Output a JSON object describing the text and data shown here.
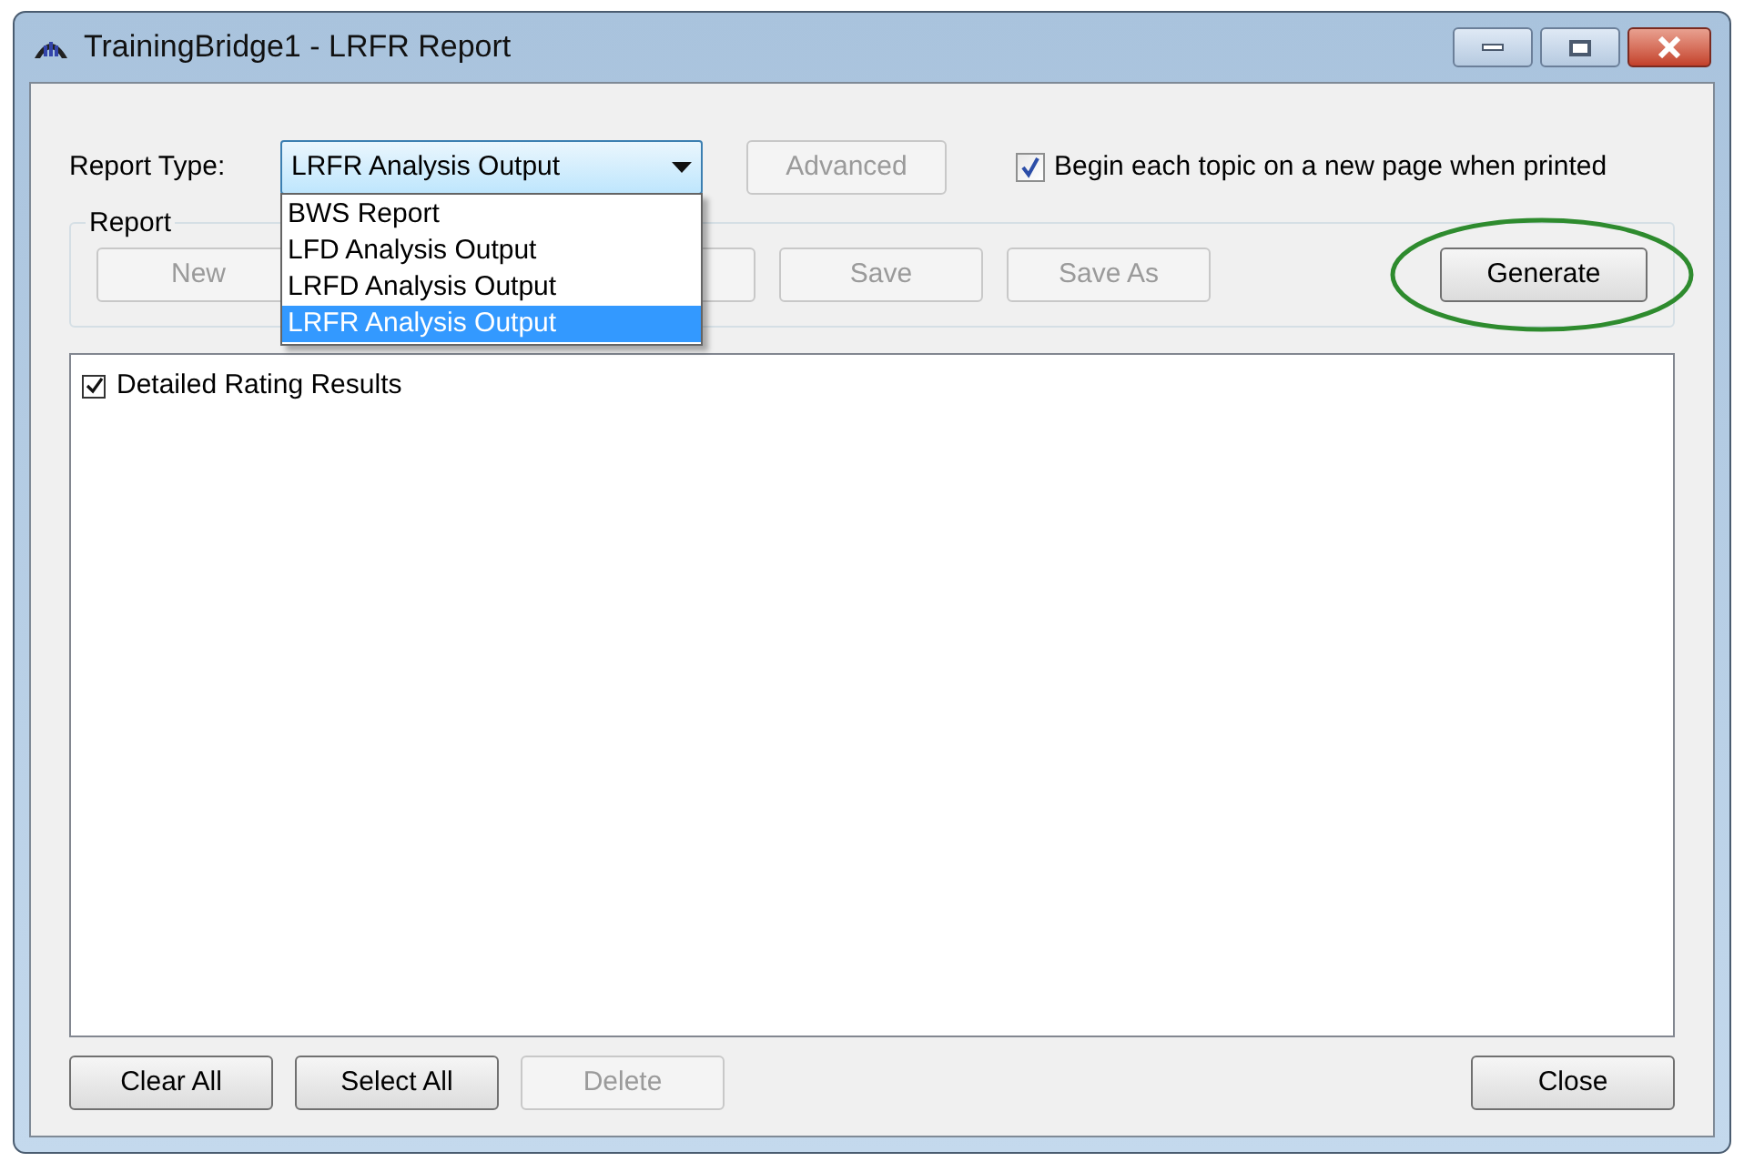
{
  "window": {
    "title": "TrainingBridge1 - LRFR Report"
  },
  "report_type": {
    "label": "Report Type:",
    "value": "LRFR Analysis Output",
    "expanded": true,
    "options": [
      {
        "label": "BWS Report",
        "selected": false
      },
      {
        "label": "LFD Analysis Output",
        "selected": false
      },
      {
        "label": "LRFD Analysis Output",
        "selected": false
      },
      {
        "label": "LRFR Analysis Output",
        "selected": true
      }
    ]
  },
  "advanced_button": {
    "label": "Advanced",
    "disabled": true
  },
  "new_page_checkbox": {
    "label": "Begin each topic on a new page when printed",
    "checked": true
  },
  "report_group": {
    "title": "Report",
    "buttons": [
      {
        "label": "New",
        "disabled": true
      },
      {
        "disabled": true
      },
      {
        "label": "Save",
        "disabled": true
      },
      {
        "label": "Save As",
        "disabled": true
      }
    ]
  },
  "generate_button": {
    "label": "Generate",
    "disabled": false,
    "highlighted": true
  },
  "topics": [
    {
      "label": "Detailed Rating Results",
      "checked": true
    }
  ],
  "bottom_buttons": [
    {
      "label": "Clear All",
      "disabled": false
    },
    {
      "label": "Select All",
      "disabled": false
    },
    {
      "label": "Delete",
      "disabled": true
    }
  ],
  "close_button": {
    "label": "Close",
    "disabled": false
  }
}
